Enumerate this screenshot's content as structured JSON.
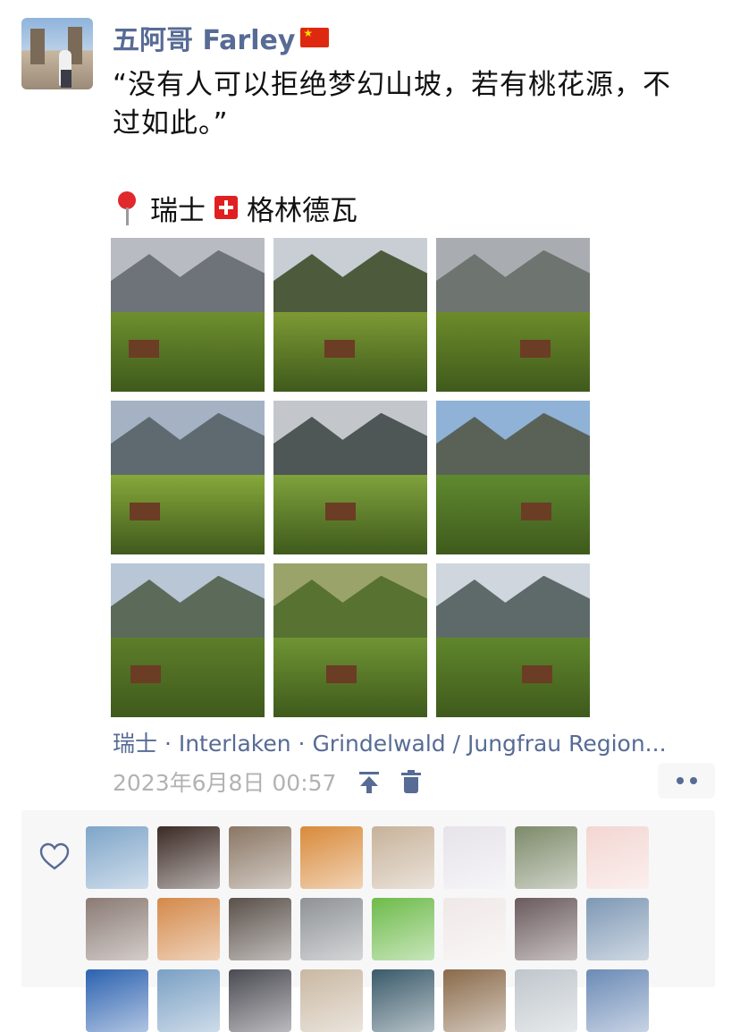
{
  "post": {
    "author": "五阿哥 Farley",
    "text": "“没有人可以拒绝梦幻山坡，若有桃花源，不\n过如此。”",
    "location_label": "瑞士",
    "location_place": "格林德瓦"
  },
  "photos": [
    {
      "name": "photo-1",
      "sky": "#b8bcc2",
      "mtn": "#6d7378",
      "field": "#6e8f2e"
    },
    {
      "name": "photo-2",
      "sky": "#c9ced4",
      "mtn": "#4d5a3c",
      "field": "#7d9a34"
    },
    {
      "name": "photo-3",
      "sky": "#a9adb2",
      "mtn": "#6e7470",
      "field": "#6c8c2a"
    },
    {
      "name": "photo-4",
      "sky": "#a4b2c4",
      "mtn": "#5f6a70",
      "field": "#86a83a"
    },
    {
      "name": "photo-5",
      "sky": "#c3c7cc",
      "mtn": "#4f5656",
      "field": "#7fa23c"
    },
    {
      "name": "photo-6",
      "sky": "#8fb2d6",
      "mtn": "#5a6258",
      "field": "#5f8a30"
    },
    {
      "name": "photo-7",
      "sky": "#b8c6d6",
      "mtn": "#5c6a5a",
      "field": "#5d7e2a"
    },
    {
      "name": "photo-8",
      "sky": "#9aa46a",
      "mtn": "#587232",
      "field": "#6f9434"
    },
    {
      "name": "photo-9",
      "sky": "#cfd6de",
      "mtn": "#5e6a6a",
      "field": "#5f862c"
    }
  ],
  "location_link": "瑞士 · Interlaken · Grindelwald / Jungfrau Region...",
  "meta": {
    "timestamp": "2023年6月8日 00:57",
    "pin_icon": "pin-top-icon",
    "delete_icon": "trash-icon",
    "more_icon": "more-dots-icon"
  },
  "likes": {
    "icon": "heart-outline-icon",
    "avatars": [
      {
        "name": "liker-avatar-1",
        "color": "#7fa5c9"
      },
      {
        "name": "liker-avatar-2",
        "color": "#3b2a24"
      },
      {
        "name": "liker-avatar-3",
        "color": "#8a7664"
      },
      {
        "name": "liker-avatar-4",
        "color": "#d98a3a"
      },
      {
        "name": "liker-avatar-5",
        "color": "#c7b29a"
      },
      {
        "name": "liker-avatar-6",
        "color": "#e6e3ea"
      },
      {
        "name": "liker-avatar-7",
        "color": "#7d8a6a"
      },
      {
        "name": "liker-avatar-8",
        "color": "#f3d6d2"
      },
      {
        "name": "liker-avatar-9",
        "color": "#8a7a74"
      },
      {
        "name": "liker-avatar-10",
        "color": "#d4894a"
      },
      {
        "name": "liker-avatar-11",
        "color": "#5a504a"
      },
      {
        "name": "liker-avatar-12",
        "color": "#8e9296"
      },
      {
        "name": "liker-avatar-13",
        "color": "#6dbb4a"
      },
      {
        "name": "liker-avatar-14",
        "color": "#efe8e6"
      },
      {
        "name": "liker-avatar-15",
        "color": "#6a5a5c"
      },
      {
        "name": "liker-avatar-16",
        "color": "#7e98b4"
      },
      {
        "name": "liker-avatar-17",
        "color": "#2c62b0"
      },
      {
        "name": "liker-avatar-18",
        "color": "#7aa0c4"
      },
      {
        "name": "liker-avatar-19",
        "color": "#4a4a52"
      },
      {
        "name": "liker-avatar-20",
        "color": "#c9b8a2"
      },
      {
        "name": "liker-avatar-21",
        "color": "#3a5a6a"
      },
      {
        "name": "liker-avatar-22",
        "color": "#8a6a4a"
      },
      {
        "name": "liker-avatar-23",
        "color": "#bfc6cc"
      },
      {
        "name": "liker-avatar-24",
        "color": "#6b8ab6"
      }
    ]
  }
}
